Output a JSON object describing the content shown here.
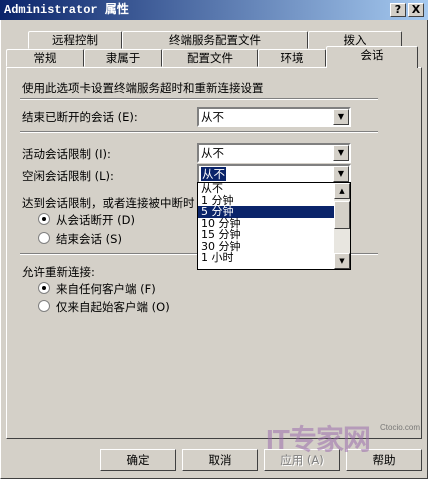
{
  "window": {
    "title": "Administrator 属性",
    "help_btn": "?",
    "close_btn": "X"
  },
  "tabs_row1": [
    "远程控制",
    "终端服务配置文件",
    "拨入"
  ],
  "tabs_row2": [
    "常规",
    "隶属于",
    "配置文件",
    "环境",
    "会话"
  ],
  "session": {
    "description": "使用此选项卡设置终端服务超时和重新连接设置",
    "disconnected_label": "结束已断开的会话 (E):",
    "disconnected_value": "从不",
    "active_label": "活动会话限制 (I):",
    "active_value": "从不",
    "idle_label": "空闲会话限制 (L):",
    "idle_value": "从不",
    "limit_label": "达到会话限制，或者连接被中断时",
    "limit_opt1": "从会话断开 (D)",
    "limit_opt2": "结束会话 (S)",
    "reconnect_label": "允许重新连接:",
    "reconnect_opt1": "来自任何客户端 (F)",
    "reconnect_opt2": "仅来自起始客户端 (O)"
  },
  "dropdown": {
    "items": [
      "从不",
      "1 分钟",
      "5 分钟",
      "10 分钟",
      "15 分钟",
      "30 分钟",
      "1 小时"
    ],
    "highlighted": "5 分钟"
  },
  "buttons": {
    "ok": "确定",
    "cancel": "取消",
    "apply": "应用 (A)",
    "help": "帮助"
  },
  "watermark": {
    "text": "IT专家网",
    "sub": "Ctocio.com"
  }
}
